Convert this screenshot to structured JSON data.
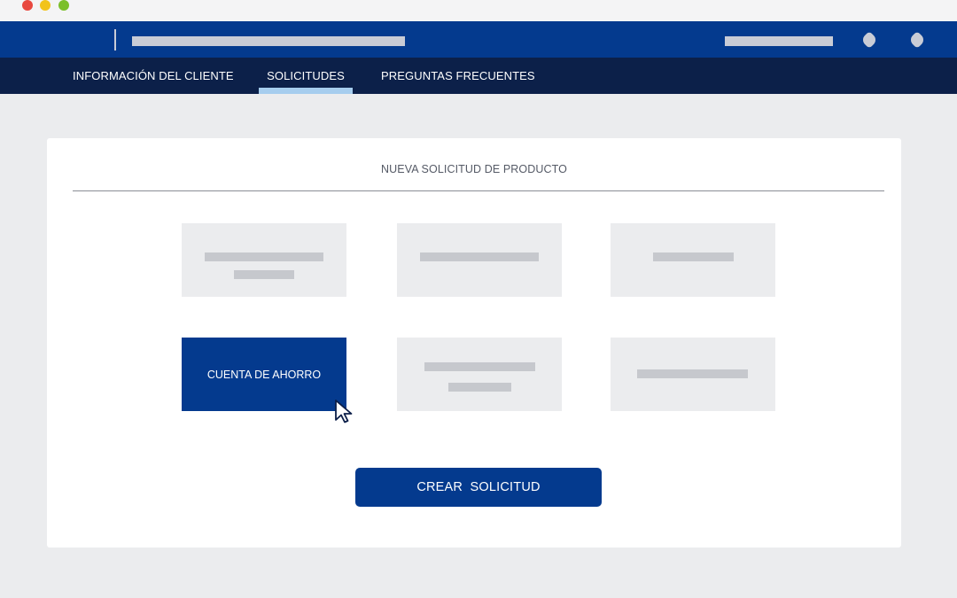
{
  "window": {
    "controls": [
      {
        "name": "close",
        "color": "#e8483f"
      },
      {
        "name": "minimize",
        "color": "#f2c31b"
      },
      {
        "name": "zoom",
        "color": "#7bbf2a"
      }
    ]
  },
  "header": {
    "icons": [
      "notifications-icon",
      "settings-icon"
    ]
  },
  "nav": {
    "tabs": [
      {
        "label": "INFORMACIÓN DEL CLIENTE",
        "active": false
      },
      {
        "label": "SOLICITUDES",
        "active": true
      },
      {
        "label": "PREGUNTAS FRECUENTES",
        "active": false
      }
    ]
  },
  "main": {
    "title": "NUEVA SOLICITUD DE PRODUCTO",
    "products": [
      {
        "label": "",
        "selected": false
      },
      {
        "label": "",
        "selected": false
      },
      {
        "label": "",
        "selected": false
      },
      {
        "label": "CUENTA DE AHORRO",
        "selected": true
      },
      {
        "label": "",
        "selected": false
      },
      {
        "label": "",
        "selected": false
      }
    ],
    "create_button": "CREAR  SOLICITUD"
  },
  "colors": {
    "primary": "#043a8e",
    "nav_background": "#0c2049",
    "active_tab_indicator": "#a6cdee",
    "page_background": "#ebecee"
  }
}
